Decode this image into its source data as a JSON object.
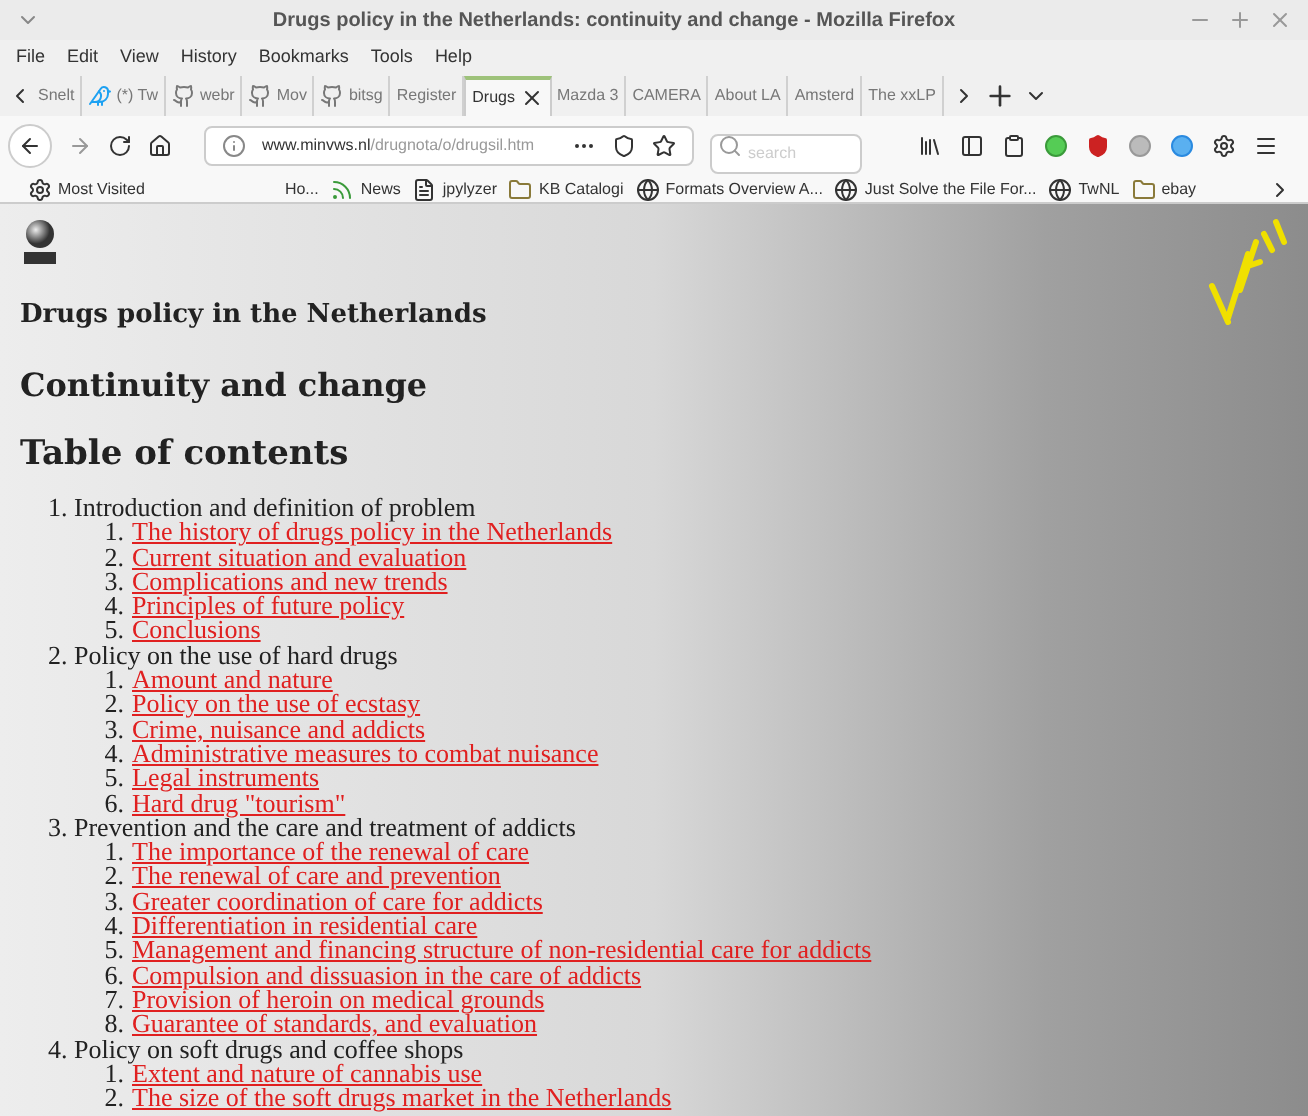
{
  "window": {
    "title": "Drugs policy in the Netherlands: continuity and change - Mozilla Firefox"
  },
  "menu": [
    "File",
    "Edit",
    "View",
    "History",
    "Bookmarks",
    "Tools",
    "Help"
  ],
  "tabs": [
    {
      "label": "Snelt",
      "kind": "plain",
      "selected": false
    },
    {
      "label": "(*) Tw",
      "kind": "bird",
      "selected": false
    },
    {
      "label": "webr",
      "kind": "github",
      "selected": false
    },
    {
      "label": "Mov",
      "kind": "github",
      "selected": false
    },
    {
      "label": "bitsg",
      "kind": "github",
      "selected": false
    },
    {
      "label": "Register",
      "kind": "plain",
      "selected": false
    },
    {
      "label": "Drugs",
      "kind": "plain",
      "selected": true
    },
    {
      "label": "Mazda 3",
      "kind": "plain",
      "selected": false
    },
    {
      "label": "CAMERA",
      "kind": "plain",
      "selected": false
    },
    {
      "label": "About LA",
      "kind": "plain",
      "selected": false
    },
    {
      "label": "Amsterd",
      "kind": "plain",
      "selected": false
    },
    {
      "label": "The xxLP",
      "kind": "plain",
      "selected": false
    }
  ],
  "address": {
    "host": "www.minvws.nl",
    "path": "/drugnota/o/drugsil.htm"
  },
  "search": {
    "placeholder": "search"
  },
  "bookmarks": [
    {
      "label": "Most Visited",
      "kind": "gear"
    },
    {
      "label": "Ho...",
      "kind": "plain"
    },
    {
      "label": "News",
      "kind": "feed"
    },
    {
      "label": "jpylyzer",
      "kind": "page"
    },
    {
      "label": "KB Catalogi",
      "kind": "folder"
    },
    {
      "label": "Formats Overview A...",
      "kind": "globe"
    },
    {
      "label": "Just Solve the File For...",
      "kind": "globe"
    },
    {
      "label": "TwNL",
      "kind": "globe"
    },
    {
      "label": "ebay",
      "kind": "folder"
    }
  ],
  "page": {
    "subtitle": "Drugs policy in the Netherlands",
    "heading": "Continuity and change",
    "toc_title": "Table of contents",
    "sections": [
      {
        "number": "1.",
        "title": "Introduction and definition of problem",
        "children": [
          {
            "number": "1.",
            "title": "The history of drugs policy in the Netherlands"
          },
          {
            "number": "2.",
            "title": "Current situation and evaluation"
          },
          {
            "number": "3.",
            "title": "Complications and new trends"
          },
          {
            "number": "4.",
            "title": "Principles of future policy"
          },
          {
            "number": "5.",
            "title": "Conclusions"
          }
        ]
      },
      {
        "number": "2.",
        "title": "Policy on the use of hard drugs",
        "children": [
          {
            "number": "1.",
            "title": "Amount and nature"
          },
          {
            "number": "2.",
            "title": "Policy on the use of ecstasy"
          },
          {
            "number": "3.",
            "title": "Crime, nuisance and addicts"
          },
          {
            "number": "4.",
            "title": "Administrative measures to combat nuisance"
          },
          {
            "number": "5.",
            "title": "Legal instruments"
          },
          {
            "number": "6.",
            "title": "Hard drug \"tourism\""
          }
        ]
      },
      {
        "number": "3.",
        "title": "Prevention and the care and treatment of addicts",
        "children": [
          {
            "number": "1.",
            "title": "The importance of the renewal of care"
          },
          {
            "number": "2.",
            "title": "The renewal of care and prevention"
          },
          {
            "number": "3.",
            "title": "Greater coordination of care for addicts"
          },
          {
            "number": "4.",
            "title": "Differentiation in residential care"
          },
          {
            "number": "5.",
            "title": "Management and financing structure of non-residential care for addicts"
          },
          {
            "number": "6.",
            "title": "Compulsion and dissuasion in the care of addicts"
          },
          {
            "number": "7.",
            "title": "Provision of heroin on medical grounds"
          },
          {
            "number": "8.",
            "title": "Guarantee of standards, and evaluation"
          }
        ]
      },
      {
        "number": "4.",
        "title": "Policy on soft drugs and coffee shops",
        "children": [
          {
            "number": "1.",
            "title": "Extent and nature of cannabis use"
          },
          {
            "number": "2.",
            "title": "The size of the soft drugs market in the Netherlands"
          }
        ]
      }
    ]
  }
}
